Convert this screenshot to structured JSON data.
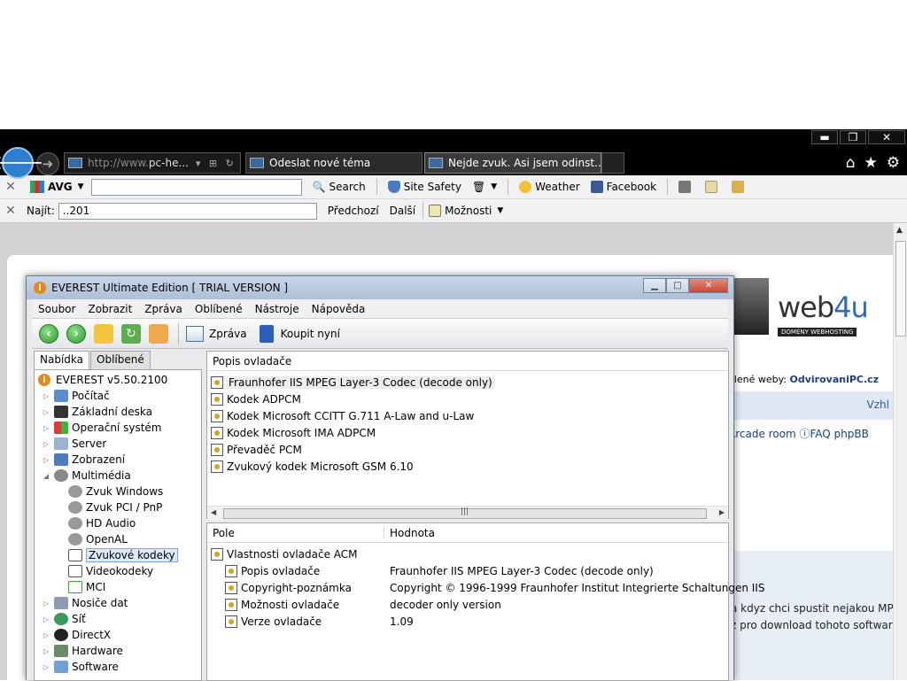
{
  "browser": {
    "window_controls": {
      "minimize": "▬",
      "restore": "❐",
      "close": "✕"
    },
    "address": {
      "prefix": "http://www.",
      "domain": "pc-he..."
    },
    "tabs": [
      {
        "label": "Odeslat nové téma"
      },
      {
        "label": "Nejde zvuk. Asi jsem odinst..."
      }
    ],
    "toolbar1": {
      "avg_label": "AVG",
      "search_value": "",
      "search_label": "Search",
      "site_safety": "Site Safety",
      "weather": "Weather",
      "facebook": "Facebook"
    },
    "findbar": {
      "label": "Najít:",
      "value": "..201",
      "prev": "Předchozí",
      "next": "Další",
      "options": "Možnosti"
    }
  },
  "webpage": {
    "logo_main": "web",
    "logo_accent": "4u",
    "logo_sub": "DOMÉNY   WEBHOSTING",
    "partners_prefix": "elené weby:",
    "partners_link": "OdvirovaniPC.cz",
    "bar_text": "Vzhl",
    "links": "Arcade room   ⓘFAQ phpBB",
    "post_line1": "a kdyz chci spustit nejakou MP",
    "post_line2": "z pro download tohoto softwar"
  },
  "everest": {
    "title": "EVEREST Ultimate Edition  [ TRIAL VERSION ]",
    "menu": [
      "Soubor",
      "Zobrazit",
      "Zpráva",
      "Oblíbené",
      "Nástroje",
      "Nápověda"
    ],
    "toolbar": {
      "report": "Zpráva",
      "buy": "Koupit nyní"
    },
    "left_tabs": [
      "Nabídka",
      "Oblíbené"
    ],
    "tree": [
      {
        "label": "EVEREST v5.50.2100",
        "level": 0,
        "exp": ""
      },
      {
        "label": "Počítač",
        "level": 1,
        "exp": "▷"
      },
      {
        "label": "Základní deska",
        "level": 1,
        "exp": "▷"
      },
      {
        "label": "Operační systém",
        "level": 1,
        "exp": "▷"
      },
      {
        "label": "Server",
        "level": 1,
        "exp": "▷"
      },
      {
        "label": "Zobrazení",
        "level": 1,
        "exp": "▷"
      },
      {
        "label": "Multimédia",
        "level": 1,
        "exp": "◢"
      },
      {
        "label": "Zvuk Windows",
        "level": 2,
        "exp": ""
      },
      {
        "label": "Zvuk PCI / PnP",
        "level": 2,
        "exp": ""
      },
      {
        "label": "HD Audio",
        "level": 2,
        "exp": ""
      },
      {
        "label": "OpenAL",
        "level": 2,
        "exp": ""
      },
      {
        "label": "Zvukové kodeky",
        "level": 2,
        "exp": "",
        "selected": true
      },
      {
        "label": "Videokodeky",
        "level": 2,
        "exp": ""
      },
      {
        "label": "MCI",
        "level": 2,
        "exp": ""
      },
      {
        "label": "Nosiče dat",
        "level": 1,
        "exp": "▷"
      },
      {
        "label": "Síť",
        "level": 1,
        "exp": "▷"
      },
      {
        "label": "DirectX",
        "level": 1,
        "exp": "▷"
      },
      {
        "label": "Hardware",
        "level": 1,
        "exp": "▷"
      },
      {
        "label": "Software",
        "level": 1,
        "exp": "▷"
      }
    ],
    "list_header": "Popis ovladače",
    "codecs": [
      "Fraunhofer IIS MPEG Layer-3 Codec (decode only)",
      "Kodek ADPCM",
      "Kodek Microsoft CCITT G.711 A-Law and u-Law",
      "Kodek Microsoft IMA ADPCM",
      "Převaděč PCM",
      "Zvukový kodek Microsoft GSM 6.10"
    ],
    "details_headers": {
      "field": "Pole",
      "value": "Hodnota"
    },
    "details_group": "Vlastnosti ovladače ACM",
    "details": [
      {
        "field": "Popis ovladače",
        "value": "Fraunhofer IIS MPEG Layer-3 Codec (decode only)"
      },
      {
        "field": "Copyright-poznámka",
        "value": "Copyright © 1996-1999 Fraunhofer Institut Integrierte Schaltungen IIS"
      },
      {
        "field": "Možnosti ovladače",
        "value": "decoder only version"
      },
      {
        "field": "Verze ovladače",
        "value": "1.09"
      }
    ]
  }
}
